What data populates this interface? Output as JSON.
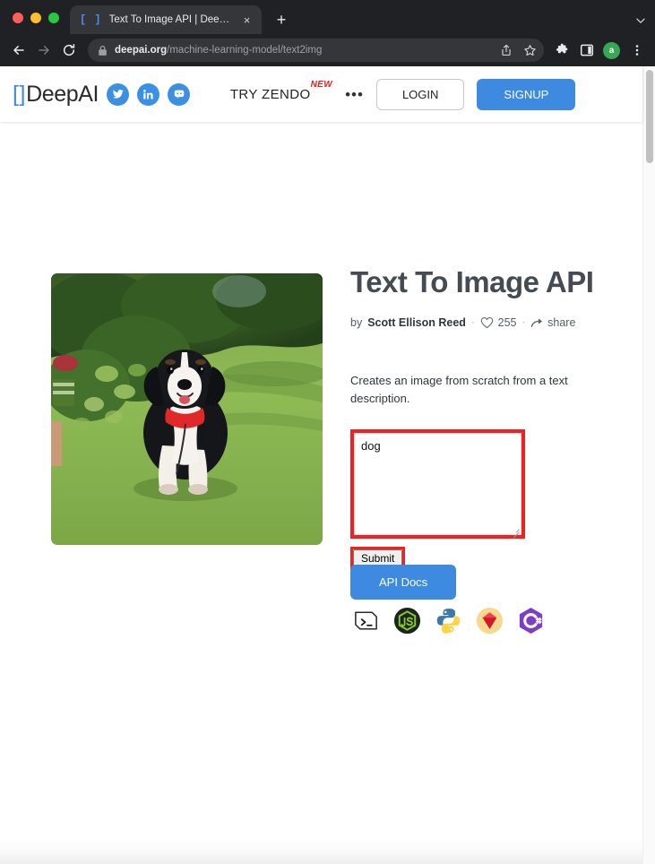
{
  "browser": {
    "traffic_lights": [
      "close",
      "minimize",
      "zoom"
    ],
    "tab": {
      "favicon": "deepai-brackets-icon",
      "title": "Text To Image API | DeepAI",
      "close_label": "×"
    },
    "new_tab_label": "+",
    "tablist_chevron": "⌄",
    "nav": {
      "back_label": "←",
      "forward_label": "→",
      "reload_label": "↻"
    },
    "omnibox": {
      "secure_icon": "lock-icon",
      "url_domain": "deepai.org",
      "url_path": "/machine-learning-model/text2img",
      "share_icon": "share-icon",
      "bookmark_icon": "star-icon"
    },
    "toolbar_icons": [
      "extensions-puzzle-icon",
      "side-panel-icon"
    ],
    "profile_initial": "a",
    "profile_color": "#34a853",
    "menu_icon": "three-dot-menu-icon"
  },
  "site_header": {
    "logo_bracket_left": "[",
    "logo_bracket_right": "]",
    "logo_text": "DeepAI",
    "social": [
      {
        "name": "twitter",
        "glyph": "twitter-icon"
      },
      {
        "name": "linkedin",
        "glyph": "linkedin-icon"
      },
      {
        "name": "discord",
        "glyph": "discord-icon"
      }
    ],
    "zendo_label": "TRY ZENDO",
    "zendo_badge": "NEW",
    "more_label": "•••",
    "login_label": "LOGIN",
    "signup_label": "SIGNUP"
  },
  "main": {
    "demo_image_alt": "Bernese Mountain Dog sitting on grass lawn with green bushes",
    "title": "Text To Image API",
    "by_label": "by",
    "author": "Scott Ellison Reed",
    "dot_separator": "·",
    "like_count": "255",
    "share_label": "share",
    "description": "Creates an image from scratch from a text description.",
    "prompt_value": "dog",
    "prompt_placeholder": "",
    "submit_label": "Submit",
    "api_docs_label": "API Docs",
    "languages": [
      {
        "name": "shell-curl",
        "label": "Shell"
      },
      {
        "name": "nodejs",
        "label": "Node.js"
      },
      {
        "name": "python",
        "label": "Python"
      },
      {
        "name": "ruby",
        "label": "Ruby"
      },
      {
        "name": "csharp",
        "label": "C#"
      }
    ]
  },
  "annotations": {
    "highlight_color": "#f42020",
    "highlighted": [
      "prompt-textarea",
      "submit-button"
    ]
  },
  "colors": {
    "brand_blue": "#3d8ae0",
    "chrome_dark": "#202124",
    "title_gray": "#444b52"
  }
}
